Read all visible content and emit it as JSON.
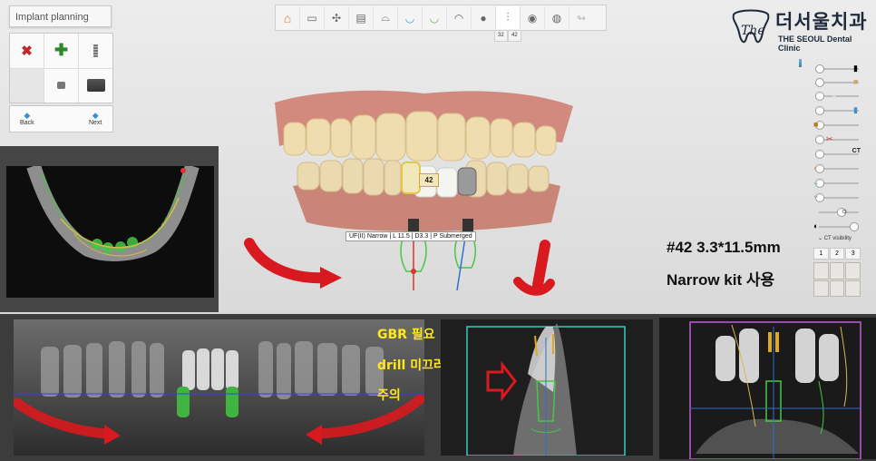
{
  "panel": {
    "title": "Implant planning",
    "back_label": "Back",
    "next_label": "Next"
  },
  "toolbar": {
    "index_left": "32",
    "index_right": "42"
  },
  "logo": {
    "korean": "더서울치과",
    "english": "THE SEOUL Dental Clinic"
  },
  "sliders": {
    "ct_label": "CT",
    "ct_visibility_label": "CT visibility",
    "buttons": [
      "1",
      "2",
      "3"
    ]
  },
  "implant": {
    "tag": "42",
    "tooltip": "UF(II) Narrow | L 11.5 | D3.3 | P Submerged"
  },
  "annotation": {
    "spec_line": "#42 3.3*11.5mm",
    "kit_line": "Narrow kit 사용"
  },
  "warning": {
    "line1": "GBR 필요",
    "line2": "drill 미끄러짐",
    "line3": "주의"
  },
  "colors": {
    "red_arrow": "#d8191f",
    "warning_text": "#ffe81a",
    "accent_blue": "#3a8fd0"
  }
}
